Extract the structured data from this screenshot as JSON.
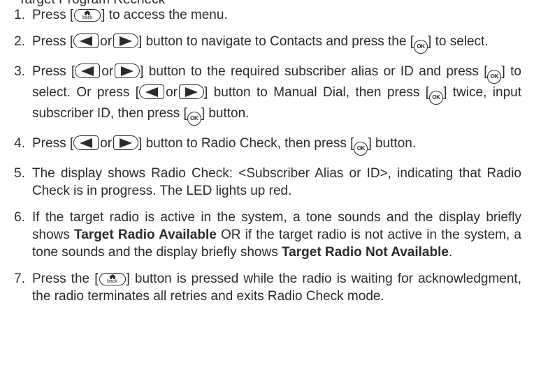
{
  "header_partial": "Target Program Recheck",
  "icons": {
    "back_button": "back-house-button-icon",
    "ok_button": "ok-button-icon",
    "left_button": "left-arrow-button-icon",
    "right_button": "right-arrow-button-icon",
    "back_label": "back",
    "ok_label": "OK"
  },
  "steps": [
    {
      "n": "1",
      "a": "Press [",
      "b": "] to access the menu."
    },
    {
      "n": "2",
      "a": "Press [",
      "or": "or",
      "b": "] button to navigate to Contacts and press the [",
      "c": "] to select."
    },
    {
      "n": "3",
      "a": "Press [",
      "or": "or",
      "b": "] button to the required subscriber alias or ID and press [",
      "c": "] to select. Or press [",
      "d": "] button to Manual Dial, then press [",
      "e": "] twice, input subscriber ID, then press [",
      "f": "] button."
    },
    {
      "n": "4",
      "a": "Press [",
      "or": "or",
      "b": "] button to Radio Check, then press [",
      "c": "] button."
    },
    {
      "n": "5",
      "text": "The display shows Radio Check: <Subscriber Alias or ID>, indicating that Radio Check is in progress. The LED lights up red."
    },
    {
      "n": "6",
      "a": "If the target radio is active in the system, a tone sounds and the display briefly shows ",
      "bold1": "Target Radio Available",
      "b": " OR if the target radio is not active in the system, a tone sounds and the display briefly shows ",
      "bold2": "Target Radio Not Available",
      "c": "."
    },
    {
      "n": "7",
      "a": "Press the [",
      "b": "] button is pressed while the radio is waiting for acknowledgment, the radio terminates all retries and exits Radio Check mode."
    }
  ]
}
